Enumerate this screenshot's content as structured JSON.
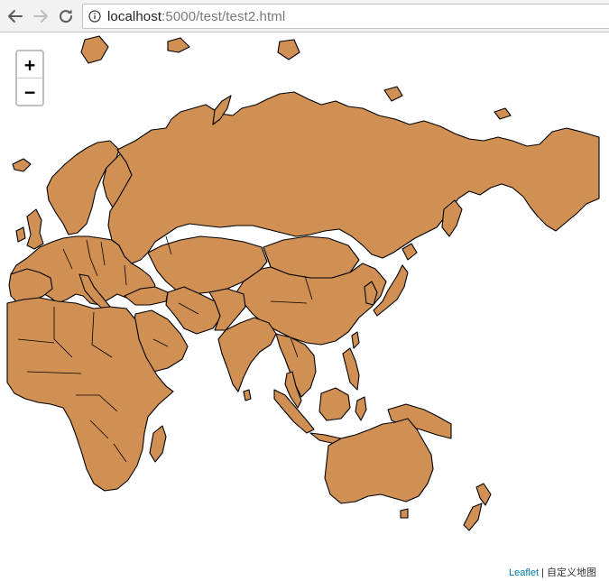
{
  "browser": {
    "url_host": "localhost",
    "url_path": ":5000/test/test2.html"
  },
  "map": {
    "land_color": "#d08f53",
    "border_color": "#000000",
    "background_color": "#ffffff",
    "zoom_in_label": "+",
    "zoom_out_label": "−",
    "attribution_link": "Leaflet",
    "attribution_separator": " | ",
    "attribution_text": "自定义地图"
  }
}
